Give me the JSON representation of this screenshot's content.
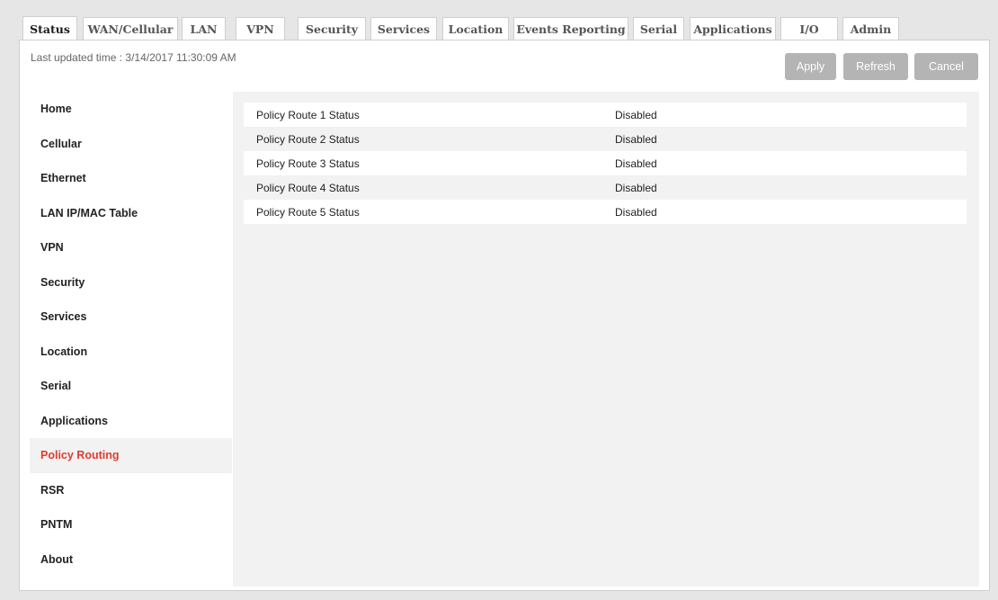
{
  "tabs": [
    {
      "label": "Status"
    },
    {
      "label": "WAN/Cellular"
    },
    {
      "label": "LAN"
    },
    {
      "label": "VPN"
    },
    {
      "label": "Security"
    },
    {
      "label": "Services"
    },
    {
      "label": "Location"
    },
    {
      "label": "Events Reporting"
    },
    {
      "label": "Serial"
    },
    {
      "label": "Applications"
    },
    {
      "label": "I/O"
    },
    {
      "label": "Admin"
    }
  ],
  "active_tab": "Status",
  "header": {
    "last_updated": "Last updated time : 3/14/2017 11:30:09 AM"
  },
  "toolbar": {
    "apply_label": "Apply",
    "refresh_label": "Refresh",
    "cancel_label": "Cancel"
  },
  "sidebar": {
    "items": [
      {
        "label": "Home"
      },
      {
        "label": "Cellular"
      },
      {
        "label": "Ethernet"
      },
      {
        "label": "LAN IP/MAC Table"
      },
      {
        "label": "VPN"
      },
      {
        "label": "Security"
      },
      {
        "label": "Services"
      },
      {
        "label": "Location"
      },
      {
        "label": "Serial"
      },
      {
        "label": "Applications"
      },
      {
        "label": "Policy Routing"
      },
      {
        "label": "RSR"
      },
      {
        "label": "PNTM"
      },
      {
        "label": "About"
      }
    ],
    "active_item": "Policy Routing"
  },
  "status_table": {
    "rows": [
      {
        "label": "Policy Route 1 Status",
        "value": "Disabled"
      },
      {
        "label": "Policy Route 2 Status",
        "value": "Disabled"
      },
      {
        "label": "Policy Route 3 Status",
        "value": "Disabled"
      },
      {
        "label": "Policy Route 4 Status",
        "value": "Disabled"
      },
      {
        "label": "Policy Route 5 Status",
        "value": "Disabled"
      }
    ]
  },
  "colors": {
    "active_nav_text": "#e03b2f",
    "button_bg": "#b4b4b4",
    "content_bg": "#f2f2f2"
  }
}
